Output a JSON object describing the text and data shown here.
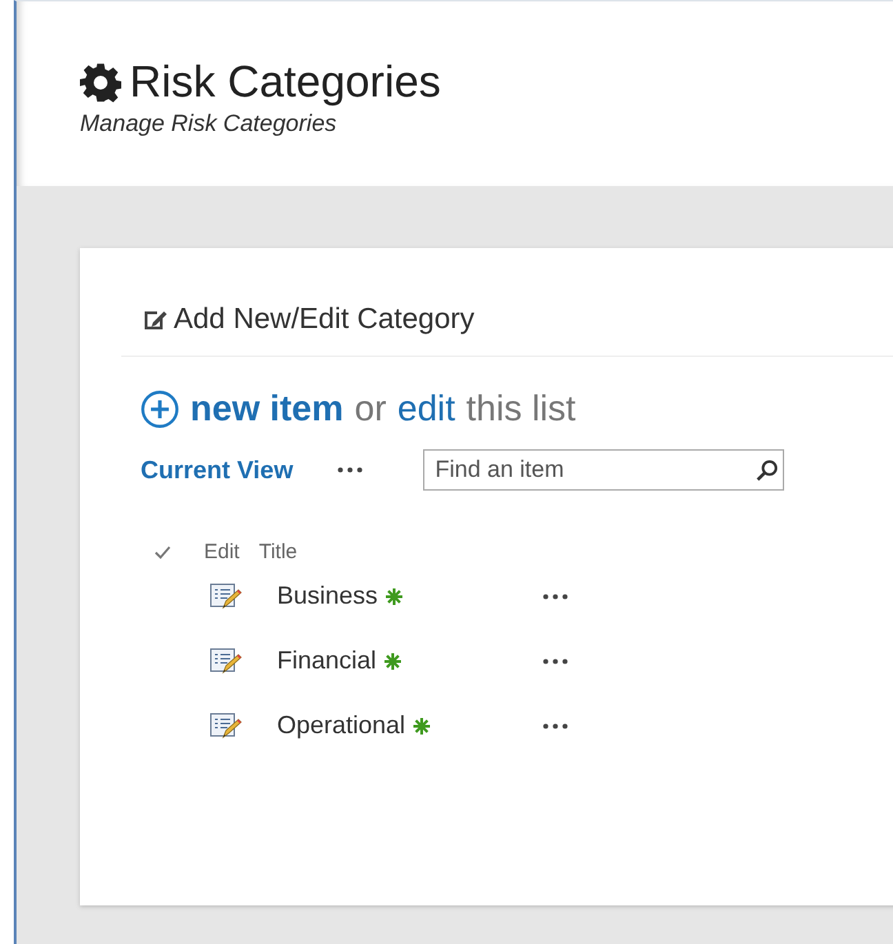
{
  "header": {
    "title": "Risk Categories",
    "subtitle": "Manage Risk Categories"
  },
  "card": {
    "heading": "Add New/Edit Category",
    "actions": {
      "new_item": "new item",
      "or": "or",
      "edit": "edit",
      "this_list": "this list"
    },
    "view": "Current View",
    "search": {
      "placeholder": "Find an item"
    },
    "columns": [
      "Edit",
      "Title"
    ],
    "rows": [
      {
        "title": "Business",
        "new": true
      },
      {
        "title": "Financial",
        "new": true
      },
      {
        "title": "Operational",
        "new": true
      }
    ]
  }
}
